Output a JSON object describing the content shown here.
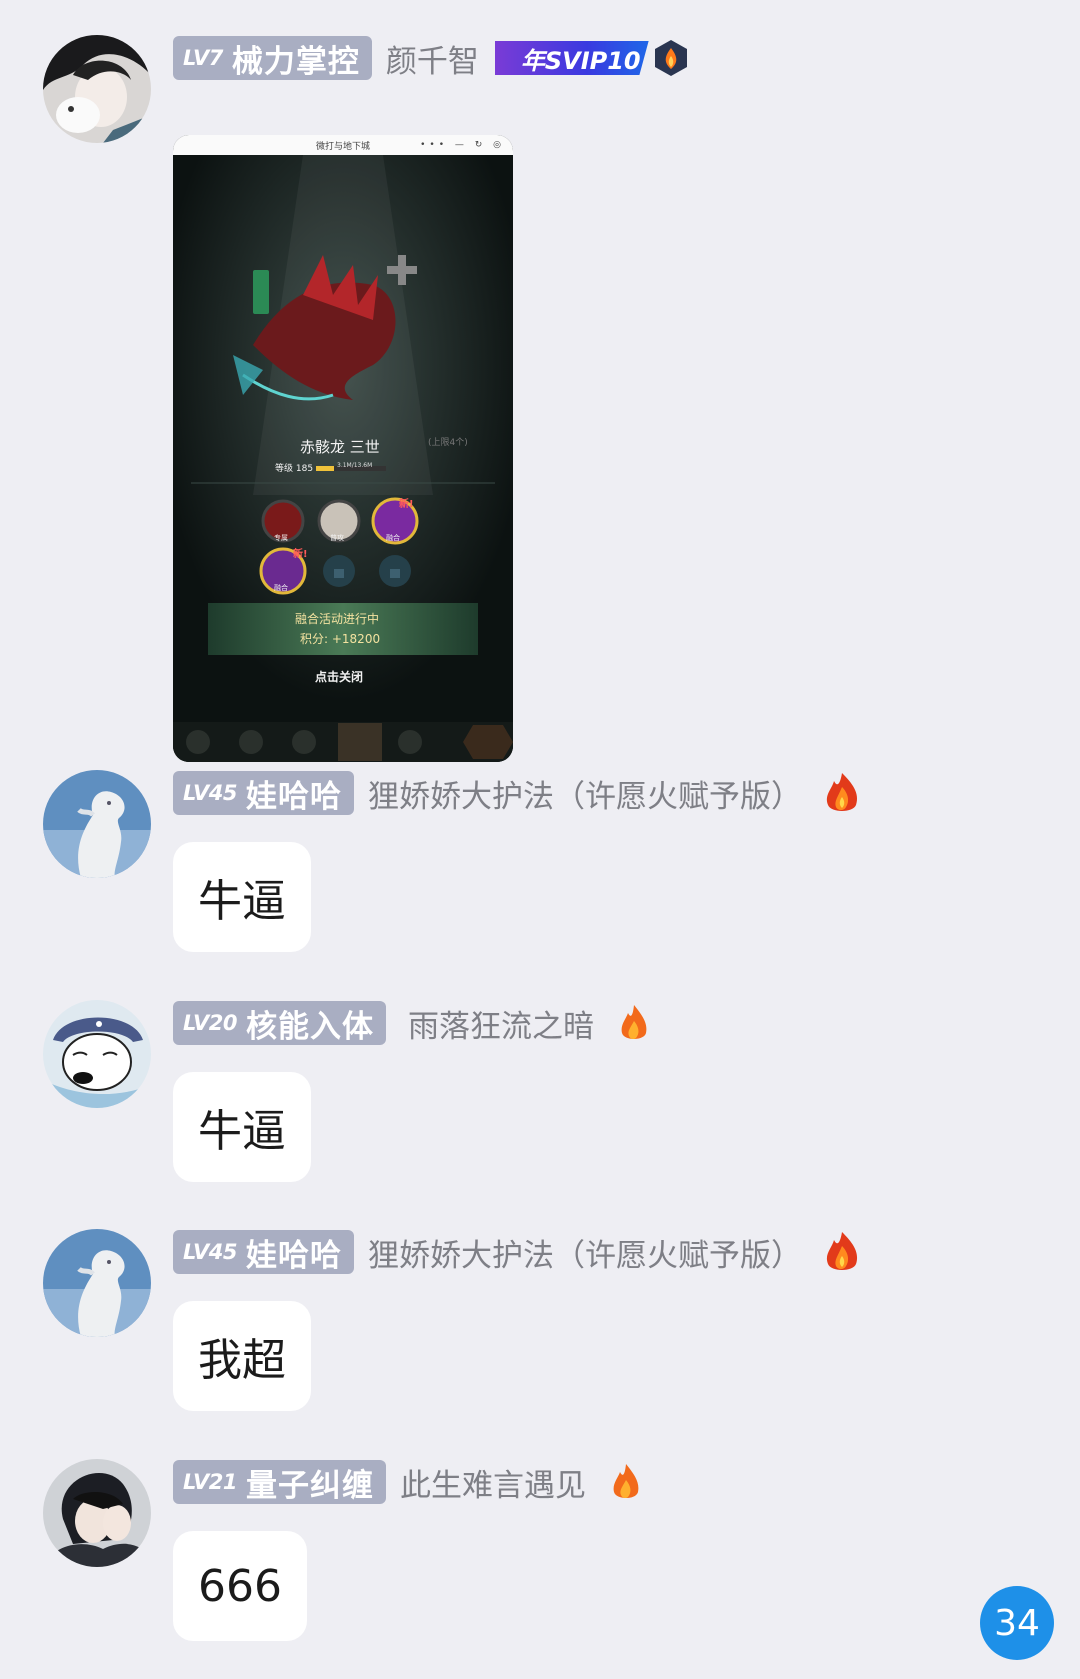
{
  "messages": [
    {
      "level": "LV7",
      "title": "械力掌控",
      "nickname": "颜千智",
      "badge": "年SVIP10",
      "avatar_icon": "avatar-girl-with-cat",
      "image": {
        "window_title": "微打与地下城",
        "character_name": "赤骸龙 三世",
        "level_text": "等级 185",
        "exp_text": "3.1M/13.6M",
        "skill_labels": [
          "专属",
          "普攻",
          "融合",
          "融合"
        ],
        "new_tag": "新!",
        "event_text": "融合活动进行中",
        "score_text": "积分: +18200",
        "close_text": "点击关闭",
        "limit_text": "(上限4个)"
      }
    },
    {
      "level": "LV45",
      "title": "娃哈哈",
      "nickname": "狸娇娇大护法（许愿火赋予版）",
      "text": "牛逼",
      "avatar_icon": "avatar-cloud-dinosaur",
      "fire_icon": "big-fire-icon"
    },
    {
      "level": "LV20",
      "title": "核能入体",
      "nickname": "雨落狂流之暗",
      "text": "牛逼",
      "avatar_icon": "avatar-sleeping-dog",
      "fire_icon": "fire-icon"
    },
    {
      "level": "LV45",
      "title": "娃哈哈",
      "nickname": "狸娇娇大护法（许愿火赋予版）",
      "text": "我超",
      "avatar_icon": "avatar-cloud-dinosaur",
      "fire_icon": "big-fire-icon"
    },
    {
      "level": "LV21",
      "title": "量子纠缠",
      "nickname": "此生难言遇见",
      "text": "666",
      "avatar_icon": "avatar-anime-couple",
      "fire_icon": "fire-icon"
    }
  ],
  "unread_count": "34",
  "colors": {
    "background": "#eeeef3",
    "level_tag": "#a9aec2",
    "nickname": "#7e7f86",
    "unread_badge": "#1e90e8"
  }
}
